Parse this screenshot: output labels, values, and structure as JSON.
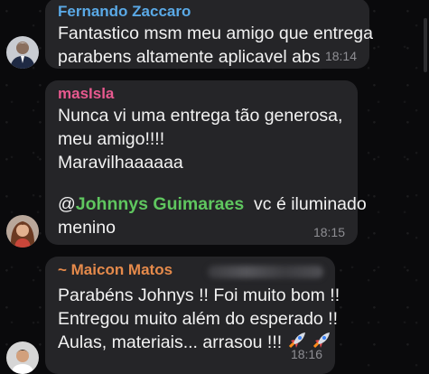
{
  "messages": [
    {
      "sender": "Fernando Zaccaro",
      "sender_color": "#5aa9e6",
      "lines": [
        "Fantastico msm meu amigo que entrega",
        "parabens altamente aplicavel abs"
      ],
      "time": "18:14"
    },
    {
      "sender": "masIsla",
      "sender_color": "#e8598f",
      "lines": [
        "Nunca vi uma entrega tão generosa,",
        "meu amigo!!!!",
        "Maravilhaaaaaa"
      ],
      "mention_prefix": "@",
      "mention_name": "Johnnys Guimaraes",
      "mention_suffix": "vc é iluminado",
      "last_line": "menino",
      "time": "18:15"
    },
    {
      "sender": "~ Maicon Matos",
      "sender_color": "#e58a4b",
      "lines": [
        "Parabéns Johnys !! Foi muito bom !!",
        "Entregou muito além do esperado !!",
        "Aulas, materiais... arrasou !!!"
      ],
      "time": "18:16"
    }
  ],
  "colors": {
    "background": "#0a0a0c",
    "bubble": "#252528",
    "mention": "#5fc65f",
    "timestamp": "#8e8e93"
  }
}
